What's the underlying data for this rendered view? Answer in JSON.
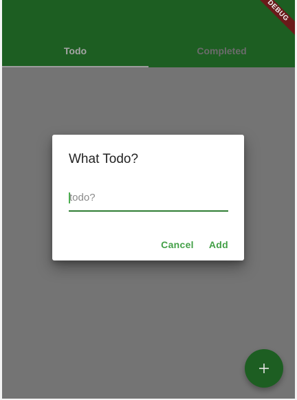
{
  "tabs": [
    {
      "label": "Todo",
      "selected": true
    },
    {
      "label": "Completed",
      "selected": false
    }
  ],
  "debug_banner": "DEBUG",
  "dialog": {
    "title": "What Todo?",
    "input_placeholder": "todo?",
    "input_value": "",
    "cancel_label": "Cancel",
    "add_label": "Add"
  },
  "fab": {
    "icon": "plus-icon"
  },
  "colors": {
    "primary": "#1d5e22",
    "accent": "#43a047",
    "scrim": "#747474"
  }
}
